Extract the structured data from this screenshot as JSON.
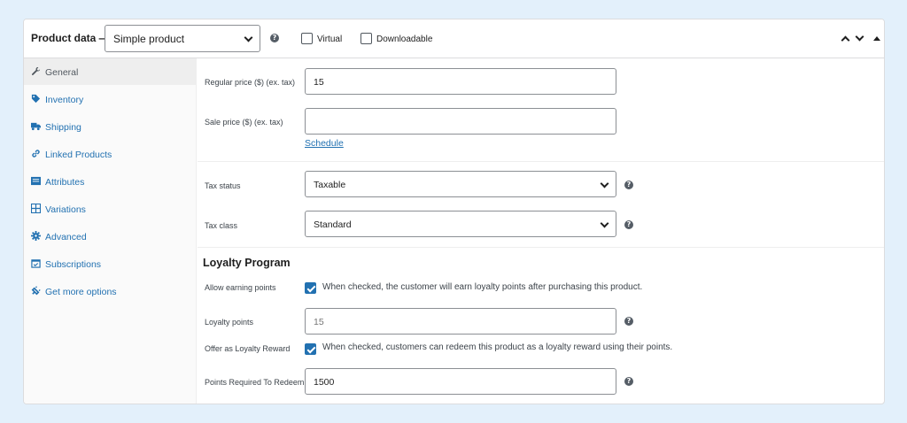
{
  "header": {
    "title": "Product data —",
    "product_type": "Simple product",
    "virtual_label": "Virtual",
    "downloadable_label": "Downloadable",
    "help_icon": "question-circle-icon",
    "up_icon": "chevron-up-icon",
    "down_icon": "chevron-down-icon",
    "toggle_icon": "triangle-up-icon"
  },
  "sidebar": {
    "items": [
      {
        "label": "General",
        "icon": "wrench-icon",
        "active": true
      },
      {
        "label": "Inventory",
        "icon": "tag-icon"
      },
      {
        "label": "Shipping",
        "icon": "truck-icon"
      },
      {
        "label": "Linked Products",
        "icon": "link-icon"
      },
      {
        "label": "Attributes",
        "icon": "list-icon"
      },
      {
        "label": "Variations",
        "icon": "grid-icon"
      },
      {
        "label": "Advanced",
        "icon": "gear-icon"
      },
      {
        "label": "Subscriptions",
        "icon": "calendar-check-icon"
      },
      {
        "label": "Get more options",
        "icon": "plugin-icon"
      }
    ]
  },
  "pricing": {
    "regular_price_label": "Regular price ($) (ex. tax)",
    "regular_price_value": "15",
    "sale_price_label": "Sale price ($) (ex. tax)",
    "sale_price_value": "",
    "schedule_link": "Schedule"
  },
  "tax": {
    "status_label": "Tax status",
    "status_value": "Taxable",
    "class_label": "Tax class",
    "class_value": "Standard"
  },
  "loyalty": {
    "title": "Loyalty Program",
    "allow_label": "Allow earning points",
    "allow_desc": "When checked, the customer will earn loyalty points after purchasing this product.",
    "points_label": "Loyalty points",
    "points_placeholder": "15",
    "reward_label": "Offer as Loyalty Reward",
    "reward_desc": "When checked, customers can redeem this product as a loyalty reward using their points.",
    "required_label": "Points Required To Redeem",
    "required_value": "1500"
  },
  "colors": {
    "accent": "#2271b1",
    "background": "#e3f0fb"
  }
}
